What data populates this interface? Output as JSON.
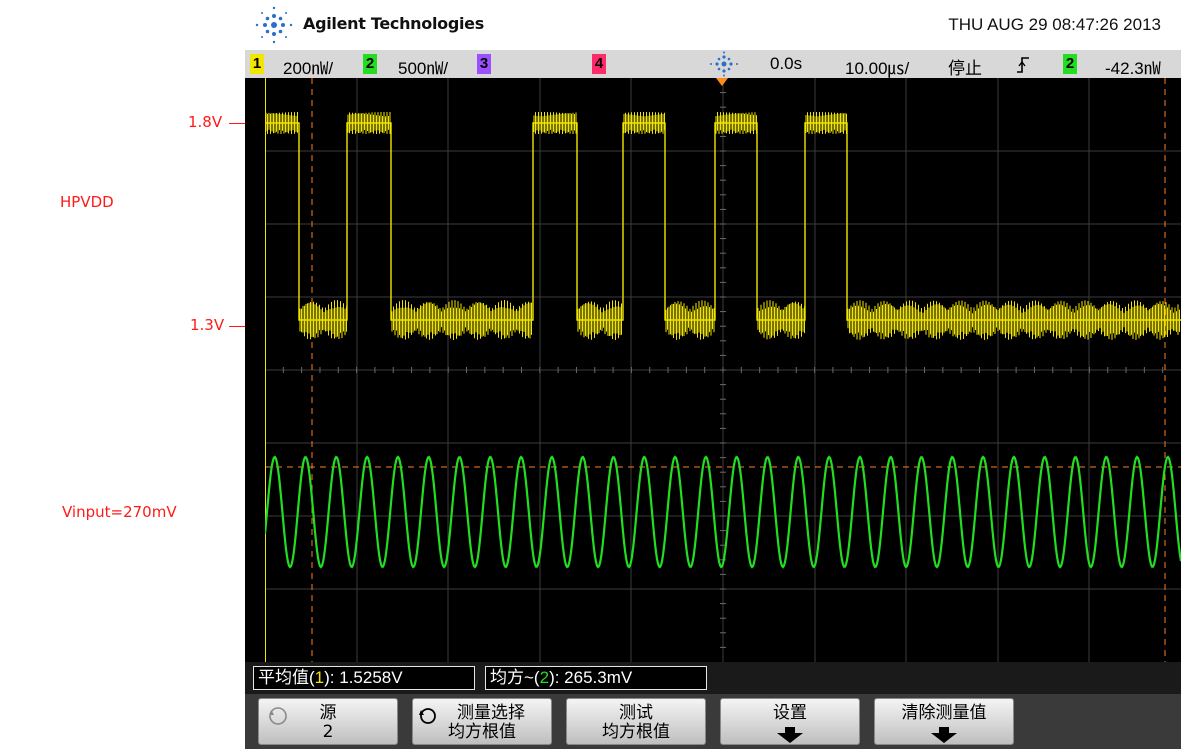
{
  "annotations": {
    "level_high": "1.8V",
    "level_low": "1.3V",
    "signal_name": "HPVDD",
    "input_label": "Vinput=270mV"
  },
  "header": {
    "brand": "Agilent Technologies",
    "datetime": "THU AUG 29 08:47:26 2013"
  },
  "status": {
    "ch1": {
      "number": "1",
      "scale": "200㎻/"
    },
    "ch2": {
      "number": "2",
      "scale": "500㎻/"
    },
    "ch3": {
      "number": "3"
    },
    "ch4": {
      "number": "4"
    },
    "delay": "0.0s",
    "timebase": "10.00㎲/",
    "run_state": "停止",
    "trigger_source": "2",
    "trigger_level": "-42.3㎻",
    "colors": {
      "ch1": "#f2e600",
      "ch2": "#22dd22",
      "ch3": "#9a50ff",
      "ch4": "#ff2a6a"
    }
  },
  "markers": {
    "ch1": "1",
    "ch2": "2"
  },
  "measurements": {
    "m1_label": "平均值(",
    "m1_ch": "1",
    "m1_value": "): 1.5258V",
    "m2_label": "均方~(",
    "m2_ch": "2",
    "m2_value": "): 265.3mV"
  },
  "softkeys": {
    "source": {
      "line1": "源",
      "line2": "2"
    },
    "select": {
      "line1": "测量选择",
      "line2": "均方根值"
    },
    "test": {
      "line1": "测试",
      "line2": "均方根值"
    },
    "setup": {
      "line1": "设置"
    },
    "clear": {
      "line1": "清除测量值"
    }
  },
  "icons": [
    "agilent-logo-icon",
    "trigger-icon",
    "trigger-edge-icon",
    "rotate-knob-icon",
    "down-arrow-icon"
  ]
}
